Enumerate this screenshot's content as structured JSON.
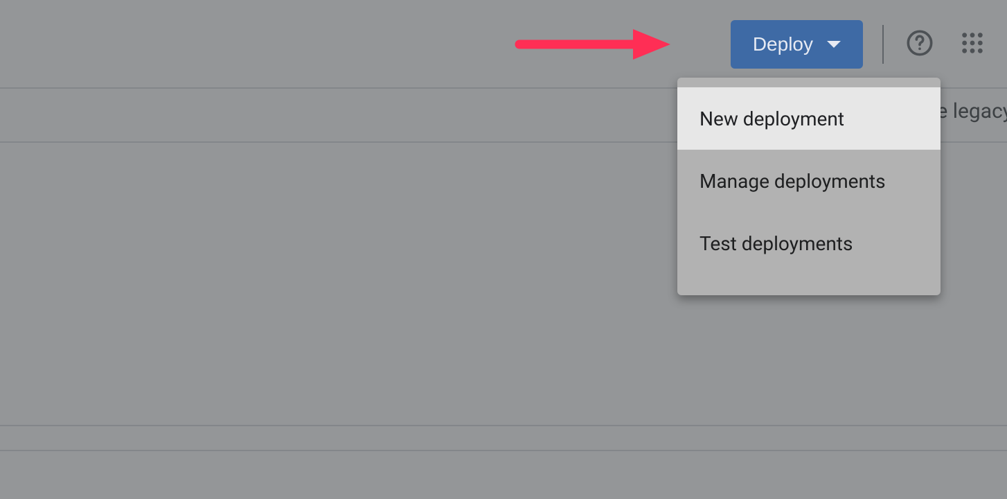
{
  "toolbar": {
    "deploy_label": "Deploy"
  },
  "menu": {
    "items": [
      "New deployment",
      "Manage deployments",
      "Test deployments"
    ]
  },
  "banner_fragment": "e legacy"
}
